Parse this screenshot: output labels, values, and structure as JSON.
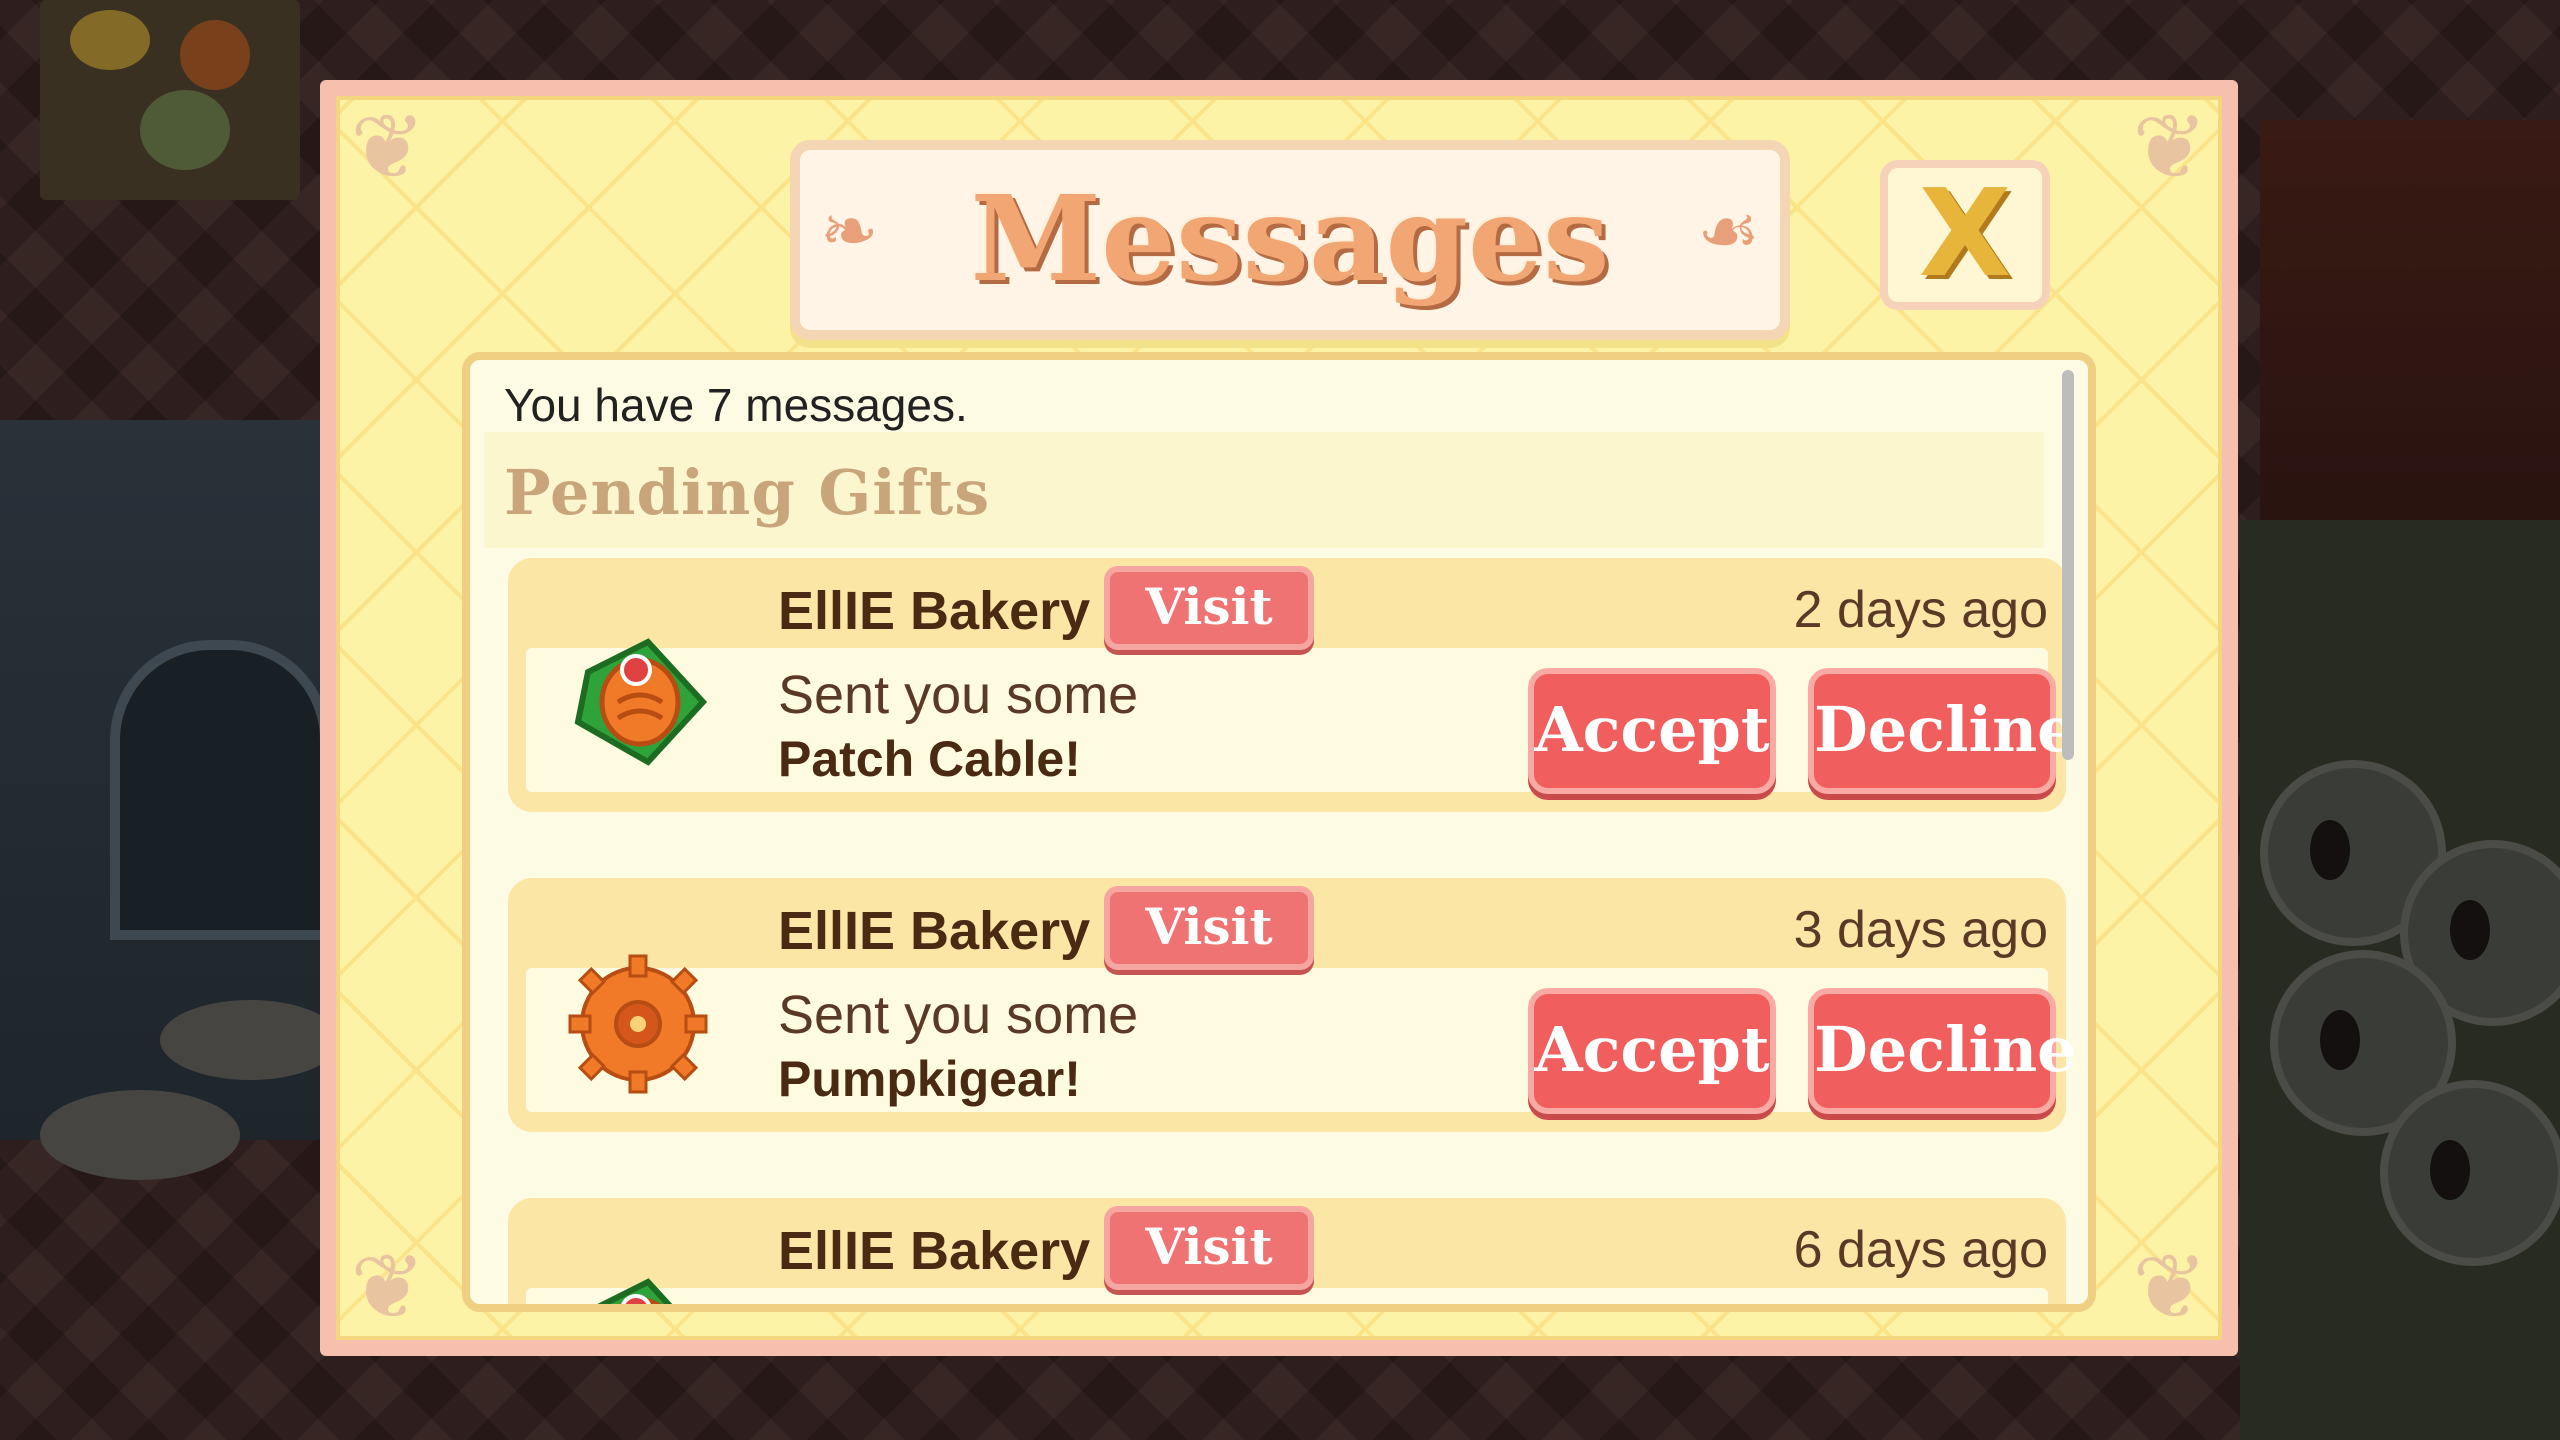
{
  "dialog": {
    "title": "Messages",
    "close_label": "X",
    "summary": "You have 7 messages.",
    "section_title": "Pending Gifts"
  },
  "gifts": [
    {
      "sender": "EllIE Bakery",
      "visit_label": "Visit",
      "time_ago": "2 days ago",
      "line1": "Sent you some",
      "item": "Patch Cable!",
      "icon": "patch-cable-icon",
      "accept_label": "Accept",
      "decline_label": "Decline"
    },
    {
      "sender": "EllIE Bakery",
      "visit_label": "Visit",
      "time_ago": "3 days ago",
      "line1": "Sent you some",
      "item": "Pumpkigear!",
      "icon": "pumpkin-gear-icon",
      "accept_label": "Accept",
      "decline_label": "Decline"
    },
    {
      "sender": "EllIE Bakery",
      "visit_label": "Visit",
      "time_ago": "6 days ago",
      "icon": "patch-cable-icon"
    }
  ],
  "colors": {
    "dialog_border": "#f7bfae",
    "dialog_fill": "#fdf3a6",
    "button_red": "#f15e5e",
    "title_orange": "#f1a673"
  }
}
